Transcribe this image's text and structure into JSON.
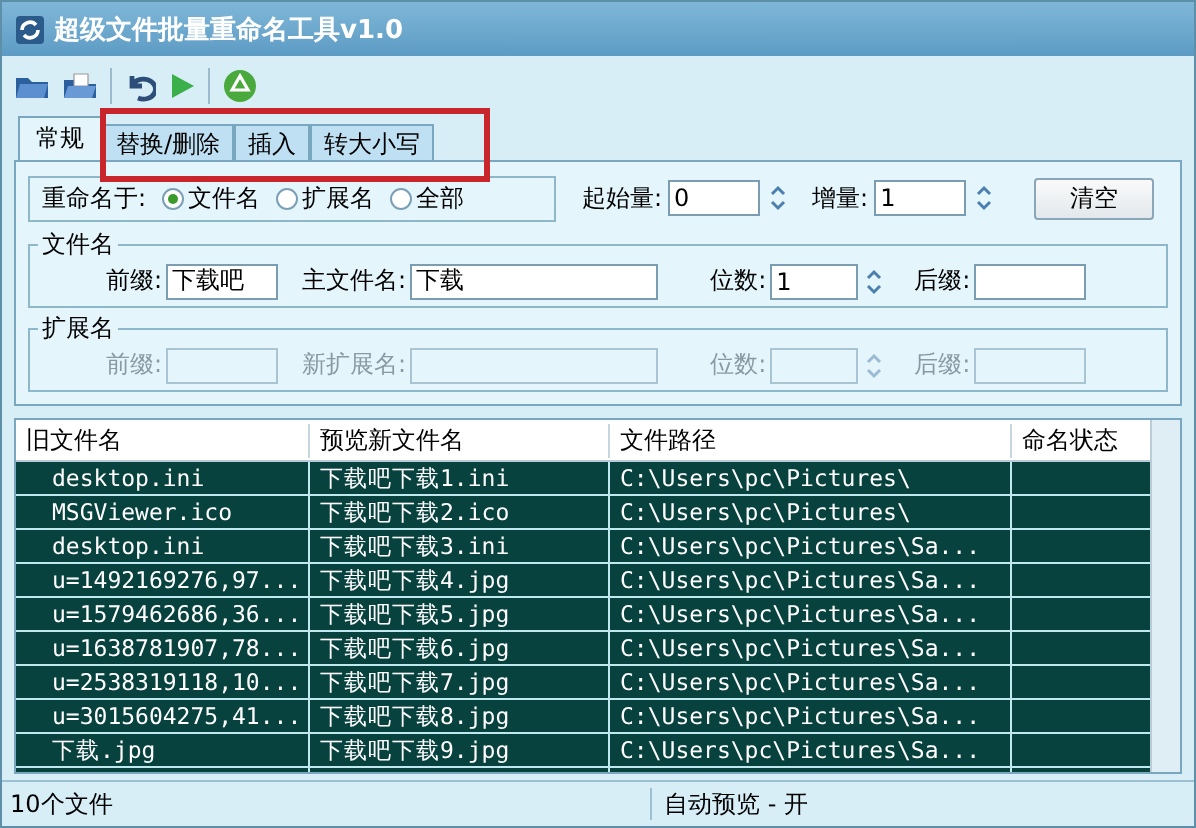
{
  "window": {
    "title": "超级文件批量重命名工具v1.0"
  },
  "toolbar": [
    {
      "kind": "folder"
    },
    {
      "kind": "open"
    },
    {
      "kind": "undo"
    },
    {
      "kind": "run"
    },
    {
      "kind": "recycle"
    }
  ],
  "tabs": [
    {
      "label": "常规",
      "selected": true
    },
    {
      "label": "替换/删除",
      "selected": false
    },
    {
      "label": "插入",
      "selected": false
    },
    {
      "label": "转大小写",
      "selected": false
    }
  ],
  "rename_target": {
    "label": "重命名于:",
    "options": [
      {
        "label": "文件名",
        "selected": true
      },
      {
        "label": "扩展名",
        "selected": false
      },
      {
        "label": "全部",
        "selected": false
      }
    ]
  },
  "start": {
    "label": "起始量:",
    "value": "0"
  },
  "increment": {
    "label": "增量:",
    "value": "1"
  },
  "clear_button": "清空",
  "groups": [
    {
      "title": "文件名",
      "disabled": false,
      "prefix": {
        "label": "前缀:",
        "value": "下载吧"
      },
      "main": {
        "label": "主文件名:",
        "value": "下载"
      },
      "digits": {
        "label": "位数:",
        "value": "1"
      },
      "suffix": {
        "label": "后缀:"
      }
    },
    {
      "title": "扩展名",
      "disabled": true,
      "prefix": {
        "label": "前缀:"
      },
      "main": {
        "label": "新扩展名:"
      },
      "digits": {
        "label": "位数:"
      },
      "suffix": {
        "label": "后缀:"
      }
    }
  ],
  "table": {
    "columns": [
      "旧文件名",
      "预览新文件名",
      "文件路径",
      "命名状态"
    ],
    "rows": [
      {
        "old": "desktop.ini",
        "new": "下载吧下载1.ini",
        "path": "C:\\Users\\pc\\Pictures\\"
      },
      {
        "old": "MSGViewer.ico",
        "new": "下载吧下载2.ico",
        "path": "C:\\Users\\pc\\Pictures\\"
      },
      {
        "old": "desktop.ini",
        "new": "下载吧下载3.ini",
        "path": "C:\\Users\\pc\\Pictures\\Sa..."
      },
      {
        "old": "u=1492169276,97...",
        "new": "下载吧下载4.jpg",
        "path": "C:\\Users\\pc\\Pictures\\Sa..."
      },
      {
        "old": "u=1579462686,36...",
        "new": "下载吧下载5.jpg",
        "path": "C:\\Users\\pc\\Pictures\\Sa..."
      },
      {
        "old": "u=1638781907,78...",
        "new": "下载吧下载6.jpg",
        "path": "C:\\Users\\pc\\Pictures\\Sa..."
      },
      {
        "old": "u=2538319118,10...",
        "new": "下载吧下载7.jpg",
        "path": "C:\\Users\\pc\\Pictures\\Sa..."
      },
      {
        "old": "u=3015604275,41...",
        "new": "下载吧下载8.jpg",
        "path": "C:\\Users\\pc\\Pictures\\Sa..."
      },
      {
        "old": "下载.jpg",
        "new": "下载吧下载9.jpg",
        "path": "C:\\Users\\pc\\Pictures\\Sa..."
      }
    ]
  },
  "status_bar": [
    "10个文件",
    "自动预览 - 开"
  ]
}
